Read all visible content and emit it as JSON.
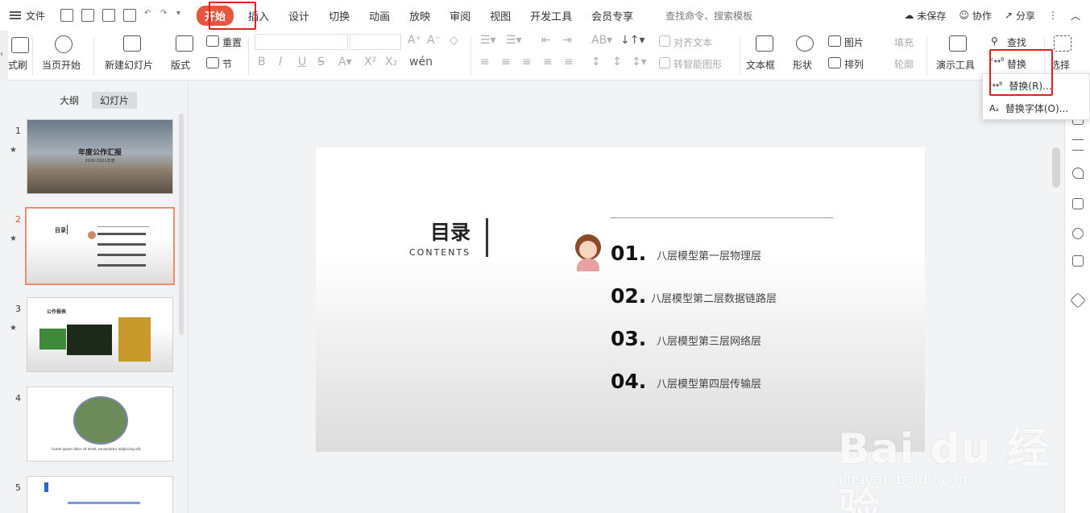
{
  "menubar": {
    "file_label": "文件",
    "tabs": [
      "开始",
      "插入",
      "设计",
      "切换",
      "动画",
      "放映",
      "审阅",
      "视图",
      "开发工具",
      "会员专享"
    ],
    "search_placeholder": "查找命令、搜索模板",
    "unsaved": "未保存",
    "collaborate": "协作",
    "share": "分享"
  },
  "ribbon": {
    "format_painter": "式刷",
    "from_start": "当页开始",
    "new_slide": "新建幻灯片",
    "layout": "版式",
    "reset": "重置",
    "section": "节",
    "align_text": "对齐文本",
    "smart_shape": "转智能图形",
    "textbox": "文本框",
    "shape": "形状",
    "picture": "图片",
    "arrange": "排列",
    "fill": "填充",
    "outline": "轮廓",
    "present_tools": "演示工具",
    "find": "查找",
    "replace": "替换",
    "select": "选择"
  },
  "replace_menu": {
    "items": [
      "替换(R)...",
      "替换字体(O)..."
    ]
  },
  "sidebar": {
    "outline_tab": "大纲",
    "slides_tab": "幻灯片",
    "slides": [
      {
        "num": "1",
        "title": "年度公作汇报",
        "subtitle": "2020 2021年度"
      },
      {
        "num": "2",
        "title": "目录"
      },
      {
        "num": "3",
        "title": "公作报表"
      },
      {
        "num": "4",
        "caption": "Lorem ipsum dolor sit amet, consectetur adipiscing elit."
      },
      {
        "num": "5"
      }
    ]
  },
  "slide": {
    "title": "目录",
    "subtitle": "CONTENTS",
    "items": [
      {
        "num": "01.",
        "text": "八层模型第一层物理层"
      },
      {
        "num": "02.",
        "text": "八层模型第二层数据链路层"
      },
      {
        "num": "03.",
        "text": "八层模型第三层网络层"
      },
      {
        "num": "04.",
        "text": "八层模型第四层传输层"
      }
    ]
  },
  "watermark": {
    "brand": "Bai du 经验",
    "url": "jingyan.baidu.com"
  },
  "colors": {
    "accent": "#e8553e",
    "highlight": "#e01f1f"
  }
}
